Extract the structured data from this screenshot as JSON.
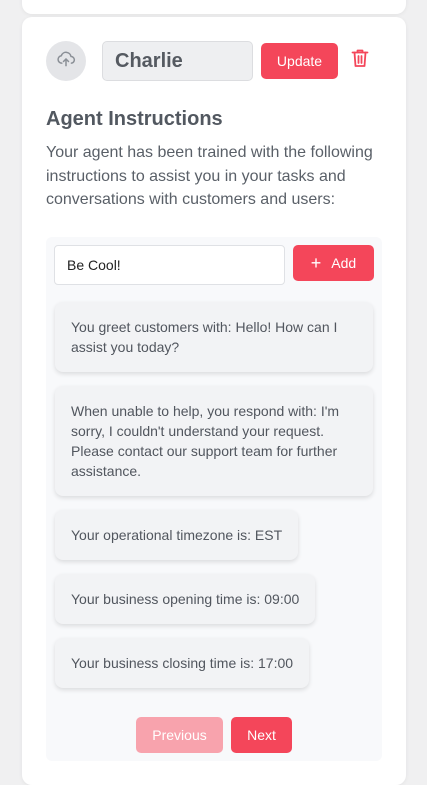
{
  "agent": {
    "name": "Charlie",
    "update_label": "Update",
    "avatar_icon": "cloud-upload-icon",
    "delete_icon": "trash-icon"
  },
  "instructions_section": {
    "title": "Agent Instructions",
    "description": "Your agent has been trained with the following instructions to assist you in your tasks and conversations with customers and users:",
    "input_value": "Be Cool!",
    "add_label": "Add",
    "items": [
      "You greet customers with: Hello! How can I assist you today?",
      "When unable to help, you respond with: I'm sorry, I couldn't understand your request. Please contact our support team for further assistance.",
      "Your operational timezone is: EST",
      "Your business opening time is: 09:00",
      "Your business closing time is: 17:00"
    ],
    "prev_label": "Previous",
    "next_label": "Next"
  },
  "colors": {
    "accent": "#f4465a",
    "accent_disabled": "#f8a3ad"
  }
}
